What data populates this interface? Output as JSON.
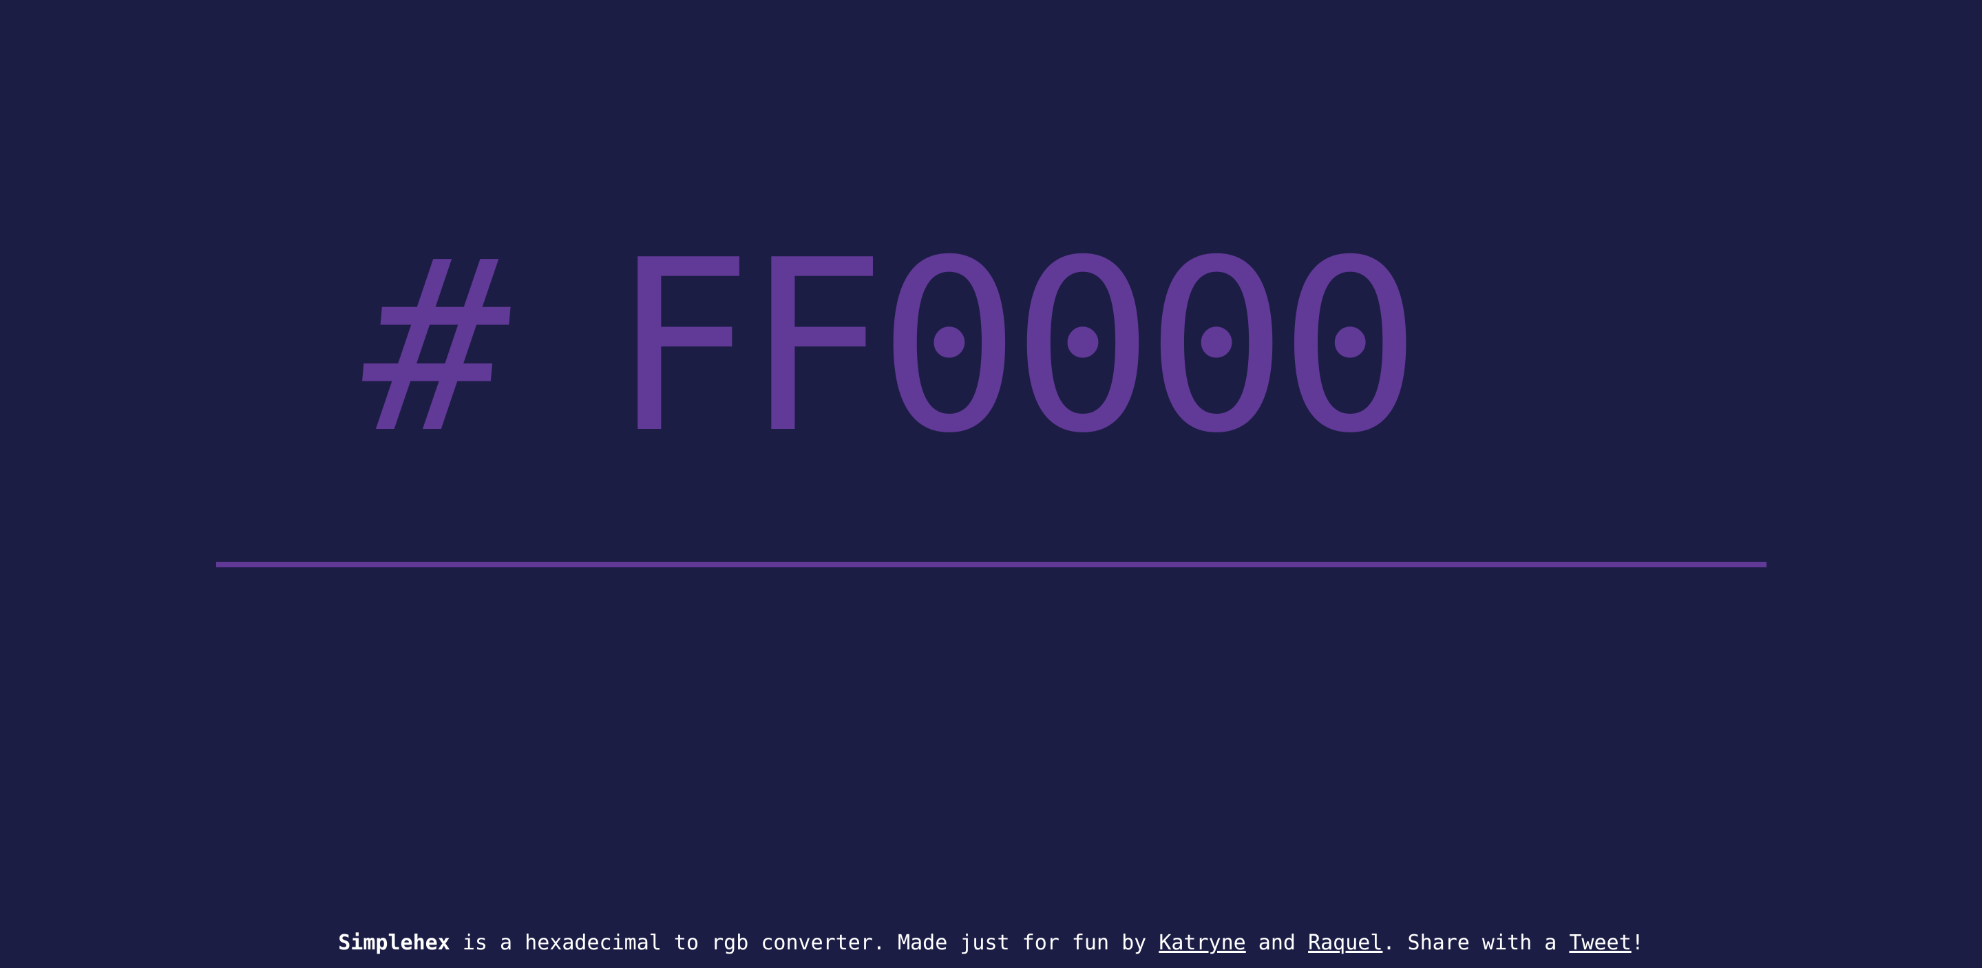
{
  "hex": {
    "prefix": "#",
    "value": "FF0000"
  },
  "footer": {
    "brand": "Simplehex",
    "text_1": " is a hexadecimal to rgb converter. Made just for fun by ",
    "link_katryne": "Katryne",
    "text_2": " and ",
    "link_raquel": "Raquel",
    "text_3": ". Share with a ",
    "link_tweet": "Tweet",
    "text_4": "!"
  },
  "colors": {
    "background": "#1c1d45",
    "accent": "#613997",
    "footer_text": "#ffffff"
  }
}
